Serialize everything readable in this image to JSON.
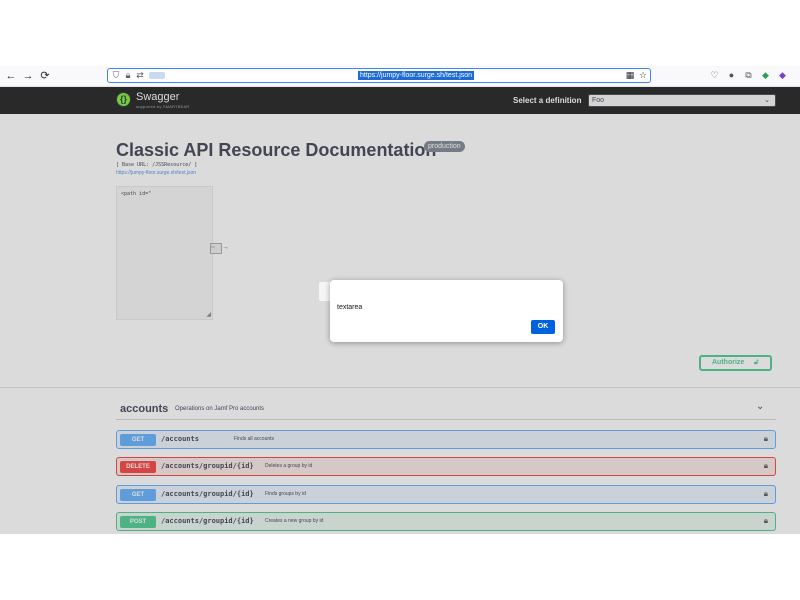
{
  "browser": {
    "back_icon": "←",
    "forward_icon": "→",
    "reload_icon": "C",
    "url": "https://jumpy-floor.surge.sh/test.json",
    "icons": [
      "shield-icon",
      "lock-icon",
      "permissions-icon",
      "extensions-grid-icon",
      "star-icon",
      "pocket-icon",
      "circle-icon",
      "puzzle-icon",
      "extension-icon",
      "extension-icon-2"
    ]
  },
  "topbar": {
    "logo_text": "Swagger",
    "logo_sub": "supported by SMARTBEAR",
    "definition_label": "Select a definition",
    "definition_value": "Foo"
  },
  "info": {
    "title": "Classic API Resource Documentation",
    "badge": "production",
    "base_url": "[ Base URL: /JSSResource/ ]",
    "spec_link": "https://jumpy-floor.surge.sh/test.json",
    "description": "<path id=\""
  },
  "authorize_label": "Authorize",
  "tag": {
    "name": "accounts",
    "description": "Operations on Jamf Pro accounts"
  },
  "operations": [
    {
      "method": "GET",
      "path": "/accounts",
      "summary": "Finds all accounts"
    },
    {
      "method": "DELETE",
      "path": "/accounts/groupid/{id}",
      "summary": "Deletes a group by id"
    },
    {
      "method": "GET",
      "path": "/accounts/groupid/{id}",
      "summary": "Finds groups by id"
    },
    {
      "method": "POST",
      "path": "/accounts/groupid/{id}",
      "summary": "Creates a new group by id"
    }
  ],
  "dialog": {
    "message": "textarea",
    "ok_label": "OK"
  },
  "colors": {
    "get": "#61affe",
    "delete": "#f93e3e",
    "post": "#49cc90",
    "topbar": "#1b1b1b",
    "accent": "#0061e0"
  }
}
